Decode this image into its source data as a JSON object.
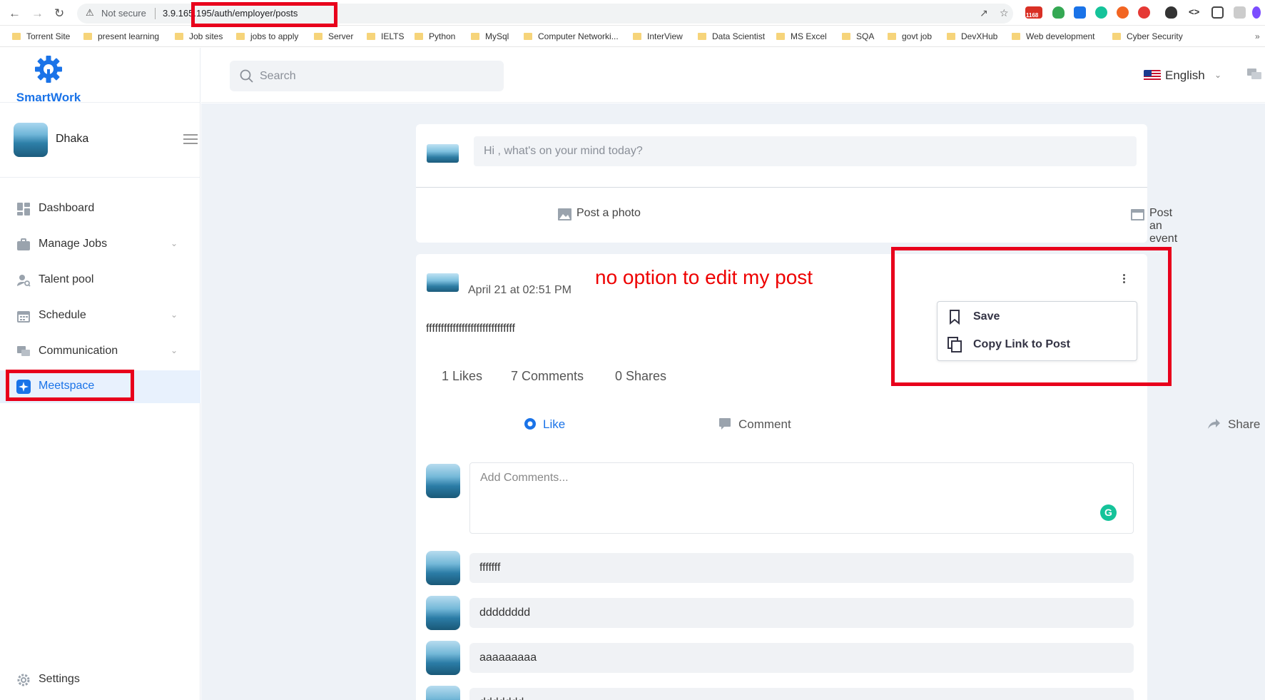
{
  "browser": {
    "not_secure": "Not secure",
    "url": "3.9.165.195/auth/employer/posts",
    "extension_badge": "1168",
    "bookmarks": [
      "Torrent Site",
      "present learning",
      "Job sites",
      "jobs to apply",
      "Server",
      "IELTS",
      "Python",
      "MySql",
      "Computer Networki...",
      "InterView",
      "Data Scientist",
      "MS Excel",
      "SQA",
      "govt job",
      "DevXHub",
      "Web development",
      "Cyber Security"
    ]
  },
  "brand": {
    "name": "SmartWork",
    "color": "#1a73e8"
  },
  "profile": {
    "name": "Dhaka"
  },
  "sidebar": {
    "items": [
      {
        "label": "Dashboard",
        "icon": "dashboard-icon"
      },
      {
        "label": "Manage Jobs",
        "icon": "briefcase-icon"
      },
      {
        "label": "Talent pool",
        "icon": "user-search-icon"
      },
      {
        "label": "Schedule",
        "icon": "calendar-icon"
      },
      {
        "label": "Communication",
        "icon": "chat-icon"
      },
      {
        "label": "Meetspace",
        "icon": "sparkle-icon"
      }
    ],
    "settings": "Settings"
  },
  "header": {
    "search_placeholder": "Search",
    "language": "English"
  },
  "composer": {
    "placeholder": "Hi , what's on your mind today?",
    "photo": "Post a photo",
    "event": "Post an event"
  },
  "post": {
    "date": "April 21 at 02:51 PM",
    "body": "ffffffffffffffffffffffffffffff",
    "likes": "1 Likes",
    "comments": "7 Comments",
    "shares": "0 Shares",
    "like_label": "Like",
    "comment_label": "Comment",
    "share_label": "Share",
    "comment_placeholder": "Add Comments...",
    "menu": {
      "save": "Save",
      "copy_link": "Copy Link to Post"
    }
  },
  "annotation": "no option to edit my post",
  "comments": [
    "fffffff",
    "dddddddd",
    "aaaaaaaaa",
    "ddddddd"
  ],
  "colors": {
    "accent": "#1a73e8",
    "annotation_red": "#e8001c"
  }
}
